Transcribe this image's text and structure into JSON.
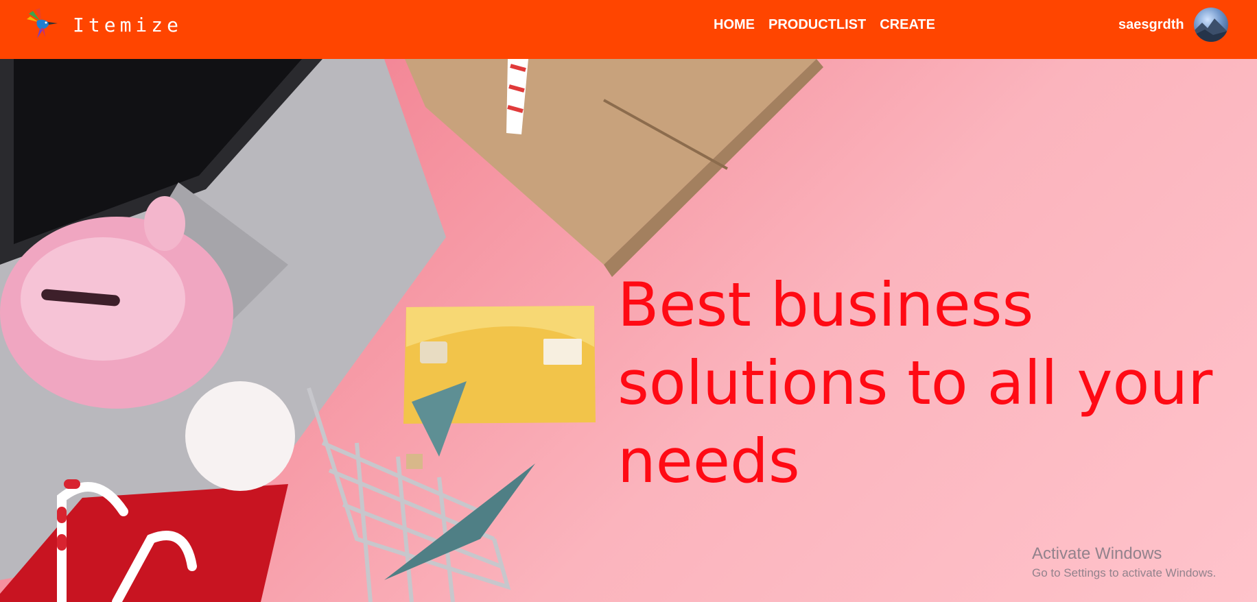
{
  "brand": {
    "name": "Itemize",
    "logo_icon": "hummingbird-logo-icon"
  },
  "nav": {
    "items": [
      {
        "label": "HOME"
      },
      {
        "label": "PRODUCTLIST"
      },
      {
        "label": "CREATE"
      }
    ]
  },
  "user": {
    "name": "saesgrdth",
    "avatar_icon": "user-avatar"
  },
  "hero": {
    "headline": "Best business solutions to all your needs"
  },
  "watermark": {
    "title": "Activate Windows",
    "subtitle": "Go to Settings to activate Windows."
  },
  "colors": {
    "navbar": "#ff4500",
    "headline": "#ff0a14",
    "hero_background": "#f5a3ad"
  }
}
